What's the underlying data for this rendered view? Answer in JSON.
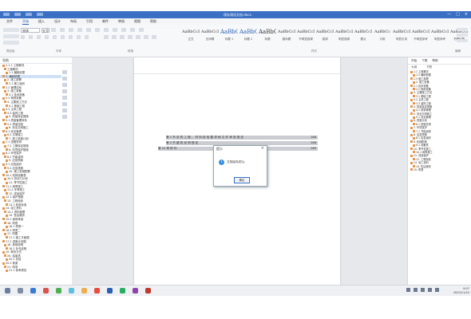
{
  "window": {
    "title": "保存测试文档.docx",
    "controls": [
      "—",
      "□",
      "×"
    ]
  },
  "menu": {
    "tabs": [
      "文件",
      "开始",
      "插入",
      "设计",
      "布局",
      "引用",
      "邮件",
      "审阅",
      "视图",
      "帮助"
    ],
    "active": "开始"
  },
  "ribbon": {
    "font_name": "宋体",
    "font_size": "五号",
    "groups": [
      "剪贴板",
      "字体",
      "段落",
      "样式",
      "编辑"
    ],
    "styles": [
      {
        "preview": "AaBbCcDi",
        "name": "正文"
      },
      {
        "preview": "AaBbCcDi",
        "name": "无间隔"
      },
      {
        "preview": "AaBbC",
        "name": "标题 1"
      },
      {
        "preview": "AaBbC",
        "name": "标题 2"
      },
      {
        "preview": "AaBbCc",
        "name": "标题"
      },
      {
        "preview": "AaBbCcDi",
        "name": "副标题"
      },
      {
        "preview": "AaBbCcDi",
        "name": "不明显强调"
      },
      {
        "preview": "AaBbCcDi",
        "name": "强调"
      },
      {
        "preview": "AaBbCcDi",
        "name": "明显强调"
      },
      {
        "preview": "AaBbCcDi",
        "name": "要点"
      },
      {
        "preview": "AaBbCc",
        "name": "引用"
      },
      {
        "preview": "AaBbCcDi",
        "name": "明显引用"
      },
      {
        "preview": "AaBbCcDi",
        "name": "不明显参考"
      },
      {
        "preview": "AaBbCcDi",
        "name": "明显参考"
      },
      {
        "preview": "AaBbCcDi",
        "name": "书籍标题"
      }
    ]
  },
  "navigation": {
    "title": "导航",
    "items": [
      "1.1.1 工程概况",
      "工程概况",
      "1.1 编制依据",
      "1. 编制依据",
      "2. 施工部署",
      "2.1 施工组织",
      "2.2 管理目标",
      "3. 施工准备",
      "3.1 技术准备",
      "3.2 物资准备",
      "4. 主要施工方法",
      "4.1 基础工程",
      "4.2 主体工程",
      "4.3 装饰工程",
      "5. 质量保证措施",
      "5.1 质量管理体系",
      "5.2 质量控制",
      "6. 安全文明施工",
      "6.1 安全管理",
      "6.2 文明施工",
      "7. 施工进度计划",
      "7.1 进度安排",
      "7.2 工期保证措施",
      "8. 环境保护措施",
      "8.1 环境保护",
      "8.2 节能减排",
      "9. 应急预案",
      "9.1 应急组织",
      "9.2 应急措施",
      "10. 施工机械配置",
      "10.1 机械设备表",
      "10.2 劳动力计划",
      "11. 季节性施工",
      "11.1 雨季施工",
      "11.2 冬季施工",
      "12. 成品保护",
      "12.1 保护措施",
      "13. 工程验收",
      "13.1 验收标准",
      "14. 竣工资料",
      "14.1 资料整理",
      "15. 售后服务",
      "15.1 保修承诺",
      "16. 附表",
      "16.1 附表一",
      "16.2 附表二",
      "17. 附图",
      "17.1 施工平面图",
      "17.2 进度计划图",
      "18. 其他说明",
      "18.1 补充说明",
      "19. 联系方式",
      "20. 结束语",
      "20.1 总结",
      "20.2 致谢",
      "21. 附录",
      "21.1 参考规范"
    ],
    "selected_index": 3
  },
  "document": {
    "toc": [
      {
        "text": "第 1 节  总 的 工 程 、 材 料 检 验 要 求 和 文 件 审 查 规 定",
        "page": "168",
        "highlight": true
      },
      {
        "text": "第 2 节  建 筑 说 明 规 定",
        "page": "168",
        "highlight": true
      },
      {
        "text": "第 10 章  附 件",
        "page": "169",
        "highlight": true
      }
    ]
  },
  "dialog": {
    "title": "提示",
    "close": "×",
    "icon": "i",
    "message": "文档保存成功。",
    "ok_label": "确定"
  },
  "right_pane": {
    "tabs": [
      "开始",
      "下载",
      "帮助"
    ],
    "sub": [
      "大纲",
      "书签"
    ],
    "items": [
      "1.1 工程概况",
      "1.2 编制依据",
      "1.3 施工部署",
      "2. 施工准备",
      "2.1 技术准备",
      "2.2 物资准备",
      "3. 主要施工方法",
      "3.1 基础工程",
      "3.2 主体工程",
      "3.3 装饰工程",
      "4. 质量保证措施",
      "4.1 质量管理",
      "5. 安全文明施工",
      "5.1 安全管理",
      "6. 进度计划",
      "6.1 进度安排",
      "7. 环境保护",
      "7.1 节能减排",
      "8. 应急预案",
      "8.1 应急组织",
      "9. 机械配置",
      "9.1 设备表",
      "10. 季节性施工",
      "10.1 雨季施工",
      "11. 成品保护",
      "12. 工程验收",
      "13. 竣工资料",
      "14. 售后服务",
      "15. 附录"
    ]
  },
  "taskbar": {
    "clock_time": "9:07",
    "clock_date": "2020/11/24"
  }
}
